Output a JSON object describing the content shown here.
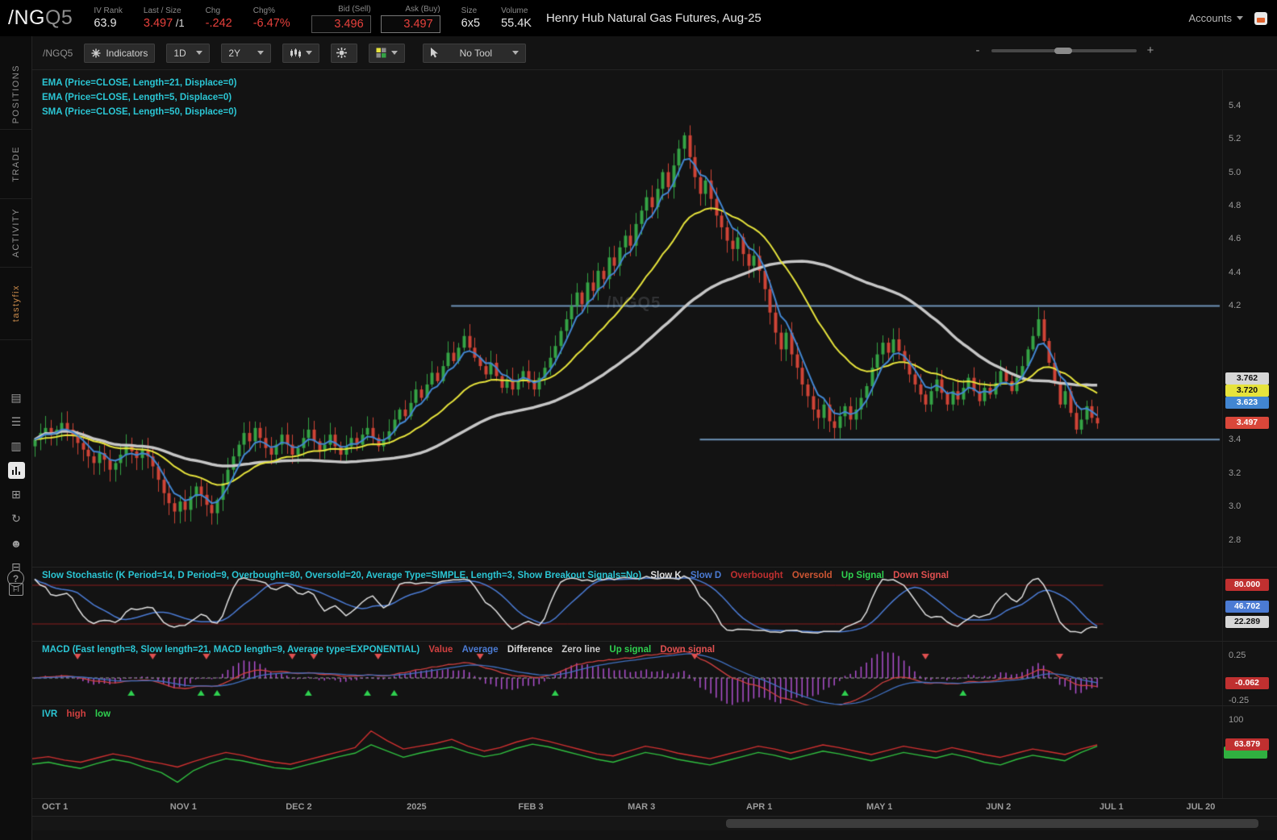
{
  "header": {
    "symbol_main": "/NG",
    "symbol_suffix": "Q5",
    "fields": [
      {
        "label": "IV Rank",
        "value": "63.9"
      },
      {
        "label": "Last / Size",
        "value": "3.497",
        "suffix": " /1"
      },
      {
        "label": "Chg",
        "value": "-.242"
      },
      {
        "label": "Chg%",
        "value": "-6.47%"
      },
      {
        "label": "Bid (Sell)",
        "value": "3.496"
      },
      {
        "label": "Ask (Buy)",
        "value": "3.497"
      },
      {
        "label": "Size",
        "value": "6x5"
      },
      {
        "label": "Volume",
        "value": "55.4K"
      }
    ],
    "instrument_name": "Henry Hub Natural Gas Futures, Aug-25",
    "accounts_label": "Accounts"
  },
  "sidebar": {
    "tabs": [
      {
        "label": "POSITIONS"
      },
      {
        "label": "TRADE"
      },
      {
        "label": "ACTIVITY"
      },
      {
        "label": "tastyfix"
      }
    ],
    "icons": [
      {
        "name": "journal-icon",
        "glyph": "▤"
      },
      {
        "name": "watchlist-icon",
        "glyph": "☰"
      },
      {
        "name": "notes-icon",
        "glyph": "▥"
      },
      {
        "name": "chart-icon",
        "glyph": "",
        "active": true
      },
      {
        "name": "grid-icon",
        "glyph": "⊞"
      },
      {
        "name": "history-icon",
        "glyph": "↻"
      },
      {
        "name": "follow-icon",
        "glyph": "☻"
      },
      {
        "name": "layers-icon",
        "glyph": "⊟"
      },
      {
        "name": "futures-icon",
        "glyph": "FI"
      }
    ],
    "help_label": "?"
  },
  "toolbar": {
    "symbol_label": "/NGQ5",
    "indicators": "Indicators",
    "timeframe": "1D",
    "range": "2Y",
    "no_tool": "No Tool",
    "zoom_minus": "-",
    "zoom_plus": "+"
  },
  "chart_legend": [
    "EMA (Price=CLOSE, Length=21, Displace=0)",
    "EMA (Price=CLOSE, Length=5, Displace=0)",
    "SMA (Price=CLOSE, Length=50, Displace=0)"
  ],
  "chart_data": {
    "type": "candlestick",
    "symbol": "/NGQ5",
    "timeframe": "1D",
    "range": "2Y",
    "watermark": "/NGQ5",
    "price_range": [
      2.64,
      5.61
    ],
    "up_color": "#35a345",
    "down_color": "#cf4436",
    "closes": [
      3.4,
      3.44,
      3.47,
      3.43,
      3.46,
      3.5,
      3.46,
      3.42,
      3.38,
      3.34,
      3.3,
      3.26,
      3.32,
      3.28,
      3.22,
      3.26,
      3.31,
      3.36,
      3.33,
      3.29,
      3.34,
      3.3,
      3.24,
      3.16,
      3.08,
      3.02,
      2.97,
      3.03,
      2.98,
      3.06,
      3.12,
      3.07,
      3.01,
      2.96,
      3.04,
      3.14,
      3.22,
      3.3,
      3.37,
      3.44,
      3.39,
      3.47,
      3.41,
      3.35,
      3.31,
      3.37,
      3.43,
      3.37,
      3.31,
      3.35,
      3.41,
      3.46,
      3.39,
      3.33,
      3.37,
      3.43,
      3.36,
      3.31,
      3.36,
      3.41,
      3.37,
      3.43,
      3.47,
      3.41,
      3.36,
      3.4,
      3.45,
      3.52,
      3.58,
      3.54,
      3.62,
      3.7,
      3.65,
      3.73,
      3.8,
      3.75,
      3.84,
      3.92,
      3.87,
      3.95,
      4.02,
      3.95,
      3.89,
      3.84,
      3.79,
      3.86,
      3.78,
      3.71,
      3.76,
      3.7,
      3.75,
      3.81,
      3.74,
      3.7,
      3.77,
      3.83,
      3.89,
      3.96,
      4.05,
      4.12,
      4.2,
      4.28,
      4.21,
      4.34,
      4.29,
      4.41,
      4.36,
      4.49,
      4.44,
      4.55,
      4.62,
      4.56,
      4.69,
      4.77,
      4.85,
      4.79,
      4.9,
      5.0,
      4.91,
      5.04,
      5.14,
      5.22,
      5.09,
      4.97,
      4.87,
      4.95,
      4.84,
      4.74,
      4.67,
      4.59,
      4.54,
      4.61,
      4.51,
      4.44,
      4.5,
      4.41,
      4.3,
      4.16,
      4.04,
      3.94,
      4.04,
      3.91,
      3.83,
      3.73,
      3.66,
      3.58,
      3.53,
      3.61,
      3.51,
      3.47,
      3.54,
      3.6,
      3.52,
      3.58,
      3.65,
      3.72,
      3.83,
      3.91,
      3.98,
      3.92,
      4.0,
      3.93,
      3.87,
      3.79,
      3.73,
      3.67,
      3.61,
      3.69,
      3.76,
      3.68,
      3.61,
      3.69,
      3.64,
      3.71,
      3.77,
      3.69,
      3.63,
      3.71,
      3.67,
      3.74,
      3.81,
      3.75,
      3.69,
      3.77,
      3.84,
      3.94,
      4.02,
      4.12,
      3.99,
      3.86,
      3.74,
      3.61,
      3.69,
      3.56,
      3.46,
      3.52,
      3.6,
      3.53,
      3.497
    ],
    "last_price": 3.497,
    "moving_averages": [
      {
        "name": "EMA5",
        "length": 5,
        "color": "#4286d1",
        "width": 2
      },
      {
        "name": "EMA21",
        "length": 21,
        "color": "#e6e33c",
        "width": 2
      },
      {
        "name": "SMA50",
        "length": 50,
        "color": "#c6c6c6",
        "width": 3.5
      }
    ],
    "support_lines": [
      {
        "price": 4.2,
        "start_frac": 0.352,
        "color": "#6e94b8"
      },
      {
        "price": 3.4,
        "start_frac": 0.561,
        "color": "#6e94b8"
      }
    ]
  },
  "price_axis": {
    "ticks": [
      "5.4",
      "5.2",
      "5.0",
      "4.8",
      "4.6",
      "4.4",
      "4.2",
      "3.4",
      "3.2",
      "3.0",
      "2.8"
    ],
    "badges": [
      {
        "text": "3.762",
        "price": 3.762,
        "bg": "#d6d6d6",
        "fg": "#111111"
      },
      {
        "text": "3.720",
        "price": 3.72,
        "bg": "#e6e33c",
        "fg": "#111111"
      },
      {
        "text": "3.623",
        "price": 3.623,
        "bg": "#4286d1",
        "fg": "#ffffff"
      },
      {
        "text": "3.497",
        "price": 3.497,
        "bg": "#d9473a",
        "fg": "#ffffff"
      }
    ]
  },
  "stoch": {
    "title": "Slow Stochastic (K Period=14, D Period=9, Overbought=80, Oversold=20, Average Type=SIMPLE, Length=3, Show Breakout Signals=No)",
    "legend": {
      "slow_k": "Slow K",
      "slow_d": "Slow D",
      "overbought": "Overbought",
      "oversold": "Oversold",
      "up": "Up Signal",
      "down": "Down Signal"
    },
    "k_period": 14,
    "d_period": 9,
    "smooth_length": 3,
    "overbought": 80,
    "oversold": 20,
    "badges": [
      {
        "text": "80.000",
        "value": 80,
        "bg": "#c03030",
        "fg": "#ffffff"
      },
      {
        "text": "46.702",
        "value": 46.702,
        "bg": "#4b7bd4",
        "fg": "#ffffff"
      },
      {
        "text": "22.289",
        "value": 22.289,
        "bg": "#d6d6d6",
        "fg": "#111111"
      }
    ]
  },
  "macd": {
    "title": "MACD (Fast length=8, Slow length=21, MACD length=9, Average type=EXPONENTIAL)",
    "legend": {
      "value": "Value",
      "average": "Average",
      "difference": "Difference",
      "zero": "Zero line",
      "up": "Up signal",
      "down": "Down signal"
    },
    "fast": 8,
    "slow": 21,
    "signal": 9,
    "axis_labels": [
      {
        "text": "0.25",
        "value": 0.25
      },
      {
        "text": "-0.25",
        "value": -0.25
      }
    ],
    "badge": {
      "text": "-0.062",
      "value": -0.062,
      "bg": "#c03030",
      "fg": "#ffffff"
    }
  },
  "ivr": {
    "title": "IVR",
    "legend": {
      "high": "high",
      "low": "low"
    },
    "axis_top": {
      "text": "100",
      "value": 100
    },
    "badge": {
      "text": "63.879",
      "value": 63.879,
      "bg": "#c03030",
      "fg": "#ffffff"
    },
    "high": [
      44,
      47,
      42,
      39,
      45,
      51,
      47,
      41,
      37,
      32,
      40,
      47,
      53,
      49,
      43,
      39,
      36,
      42,
      48,
      54,
      60,
      84,
      70,
      58,
      62,
      66,
      72,
      62,
      55,
      60,
      68,
      74,
      69,
      63,
      57,
      51,
      48,
      55,
      62,
      58,
      52,
      48,
      44,
      50,
      56,
      62,
      58,
      52,
      58,
      64,
      60,
      55,
      50,
      56,
      62,
      58,
      54,
      60,
      55,
      50,
      46,
      52,
      58,
      54,
      50,
      58,
      64
    ],
    "low": [
      36,
      39,
      34,
      30,
      37,
      43,
      39,
      31,
      24,
      10,
      27,
      37,
      44,
      41,
      36,
      31,
      29,
      35,
      41,
      47,
      52,
      64,
      55,
      46,
      52,
      57,
      61,
      53,
      47,
      51,
      59,
      65,
      61,
      55,
      49,
      43,
      39,
      46,
      53,
      49,
      43,
      39,
      35,
      41,
      47,
      53,
      49,
      43,
      49,
      55,
      51,
      46,
      41,
      47,
      53,
      49,
      45,
      51,
      46,
      39,
      35,
      43,
      49,
      45,
      41,
      53,
      62
    ]
  },
  "time_axis": [
    {
      "label": "OCT 1",
      "frac": 0.019
    },
    {
      "label": "NOV 1",
      "frac": 0.127
    },
    {
      "label": "DEC 2",
      "frac": 0.224
    },
    {
      "label": "2025",
      "frac": 0.323
    },
    {
      "label": "FEB 3",
      "frac": 0.419
    },
    {
      "label": "MAR 3",
      "frac": 0.512
    },
    {
      "label": "APR 1",
      "frac": 0.611
    },
    {
      "label": "MAY 1",
      "frac": 0.712
    },
    {
      "label": "JUN 2",
      "frac": 0.812
    },
    {
      "label": "JUL 1",
      "frac": 0.907
    },
    {
      "label": "JUL 20",
      "frac": 0.982
    }
  ]
}
